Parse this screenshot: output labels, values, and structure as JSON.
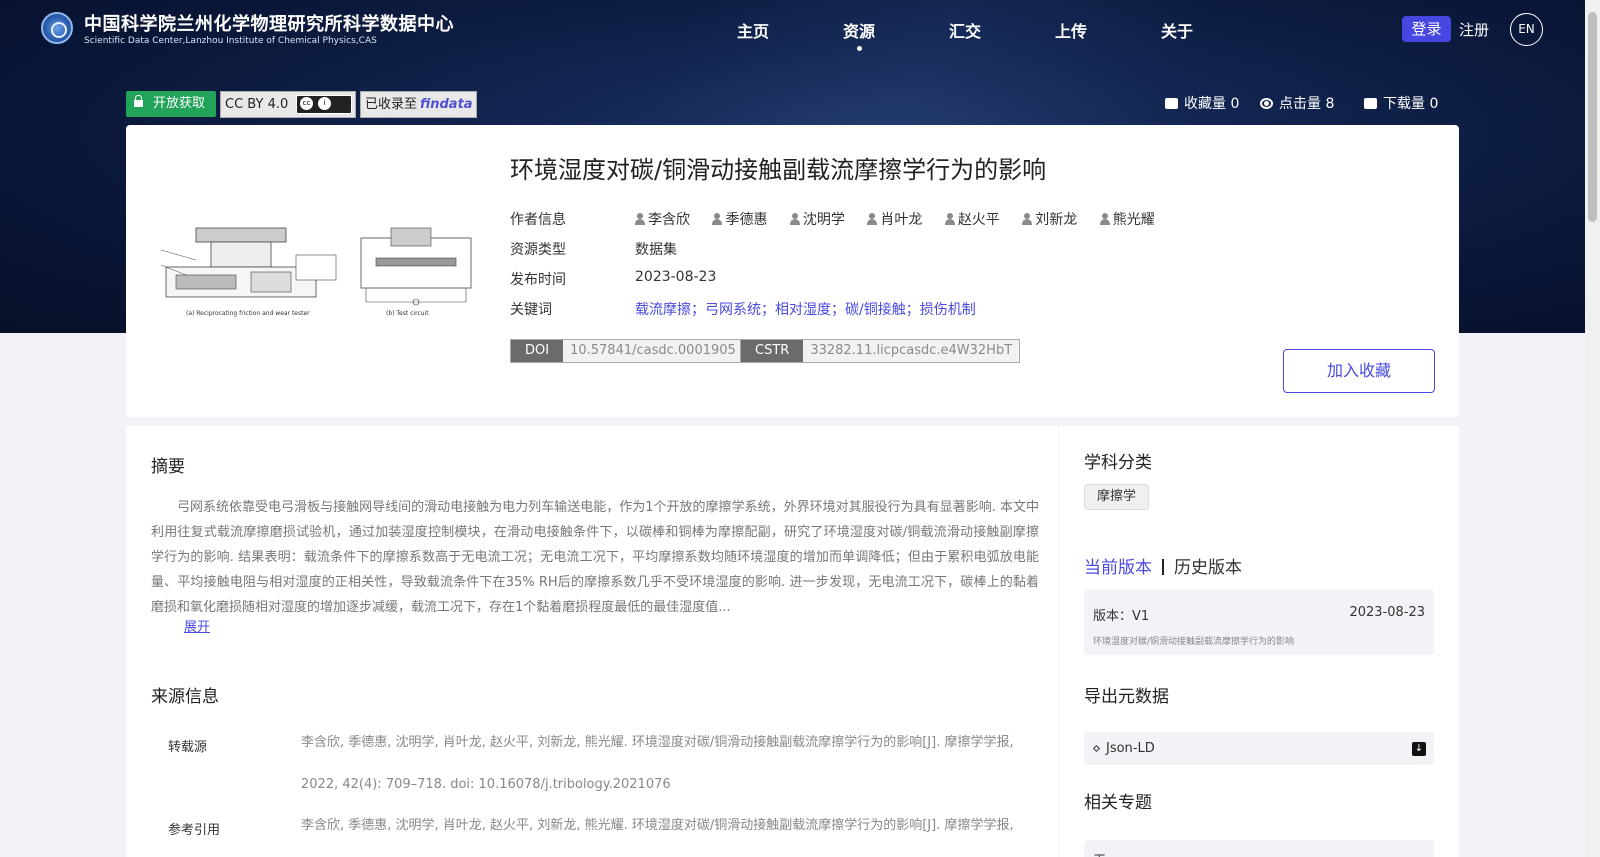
{
  "header": {
    "site_title": "中国科学院兰州化学物理研究所科学数据中心",
    "site_subtitle": "Scientific Data Center,Lanzhou Institute of Chemical Physics,CAS",
    "nav": [
      "主页",
      "资源",
      "汇交",
      "上传",
      "关于"
    ],
    "active_nav": "资源",
    "login": "登录",
    "register": "注册",
    "lang": "EN"
  },
  "badges": {
    "open_access": "开放获取",
    "license": "CC BY 4.0",
    "cc_logo_text": "cc",
    "findata_prefix": "已收录至",
    "findata_name": "findata"
  },
  "stats": {
    "favorites": "收藏量 0",
    "clicks": "点击量 8",
    "downloads": "下载量 0"
  },
  "dataset": {
    "title": "环境湿度对碳/铜滑动接触副载流摩擦学行为的影响",
    "labels": {
      "authors": "作者信息",
      "type": "资源类型",
      "date": "发布时间",
      "keywords": "关键词"
    },
    "authors": [
      "李含欣",
      "季德惠",
      "沈明学",
      "肖叶龙",
      "赵火平",
      "刘新龙",
      "熊光耀"
    ],
    "type": "数据集",
    "date": "2023-08-23",
    "keywords": "载流摩擦；弓网系统；相对湿度；碳/铜接触；损伤机制",
    "doi_label": "DOI",
    "doi": "10.57841/casdc.0001905",
    "cstr_label": "CSTR",
    "cstr": "33282.11.licpcasdc.e4W32HbT",
    "fav_button": "加入收藏",
    "figure_caption_a": "(a) Reciprocating friction and wear tester",
    "figure_caption_b": "(b) Test circuit"
  },
  "abstract": {
    "title": "摘要",
    "text": "弓网系统依靠受电弓滑板与接触网导线间的滑动电接触为电力列车输送电能，作为1个开放的摩擦学系统，外界环境对其服役行为具有显著影响. 本文中利用往复式载流摩擦磨损试验机，通过加装湿度控制模块，在滑动电接触条件下，以碳棒和铜棒为摩擦配副，研究了环境湿度对碳/铜载流滑动接触副摩擦学行为的影响. 结果表明：载流条件下的摩擦系数高于无电流工况；无电流工况下，平均摩擦系数均随环境湿度的增加而单调降低；但由于累积电弧放电能量、平均接触电阻与相对湿度的正相关性，导致载流条件下在35% RH后的摩擦系数几乎不受环境湿度的影响. 进一步发现，无电流工况下，碳棒上的黏着磨损和氧化磨损随相对湿度的增加逐步减缓，载流工况下，存在1个黏着磨损程度最低的最佳湿度值...",
    "expand": "展开"
  },
  "source": {
    "title": "来源信息",
    "reprint_label": "转载源",
    "reprint_text": "李含欣, 季德惠, 沈明学, 肖叶龙, 赵火平, 刘新龙, 熊光耀. 环境湿度对碳/铜滑动接触副载流摩擦学行为的影响[J]. 摩擦学学报, 2022, 42(4): 709–718. doi: 10.16078/j.tribology.2021076",
    "cite_label": "参考引用",
    "cite_text": "李含欣, 季德惠, 沈明学, 肖叶龙, 赵火平, 刘新龙, 熊光耀. 环境湿度对碳/铜滑动接触副载流摩擦学行为的影响[J]. 摩擦学学报,"
  },
  "sidebar": {
    "subject_title": "学科分类",
    "subject_tag": "摩擦学",
    "current_version": "当前版本",
    "history_version": "历史版本",
    "version": "版本：V1",
    "version_date": "2023-08-23",
    "version_title": "环境湿度对碳/铜滑动接触副载流摩擦学行为的影响",
    "export_title": "导出元数据",
    "export_format": "Json-LD",
    "topics_title": "相关专题",
    "topics_value": "无"
  }
}
